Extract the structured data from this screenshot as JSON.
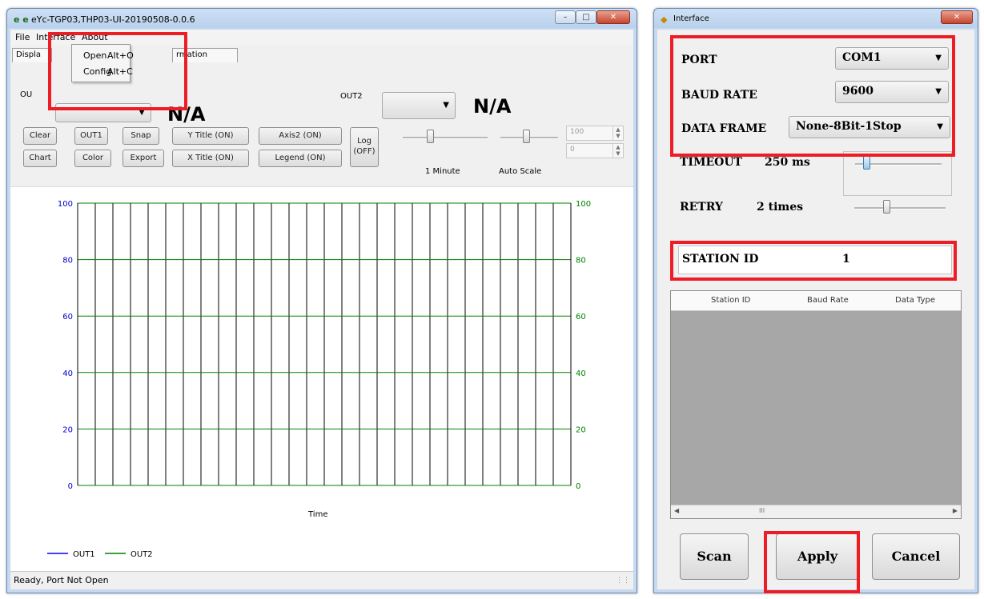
{
  "main_window": {
    "title": "eYc-TGP03,THP03-UI-20190508-0.0.6",
    "app_icon": "e e",
    "menu": {
      "file": "File",
      "interface": "Interface",
      "about": "About",
      "interface_items": [
        {
          "label": "Open",
          "accelerator": "Alt+O"
        },
        {
          "label": "Config",
          "accelerator": "Alt+C"
        }
      ]
    },
    "tabs": [
      {
        "label": "Displa"
      },
      {
        "label": "rmation"
      }
    ],
    "out1_label": "OU",
    "out1_value": "N/A",
    "out2_label": "OUT2",
    "out2_value": "N/A",
    "buttons_row1": [
      "Clear",
      "OUT1",
      "Snap",
      "Y Title (ON)",
      "Axis2 (ON)"
    ],
    "buttons_row2": [
      "Chart",
      "Color",
      "Export",
      "X Title (ON)",
      "Legend (ON)"
    ],
    "log_button": [
      "Log",
      "(OFF)"
    ],
    "time_slider_label": "1 Minute",
    "scale_slider_label": "Auto Scale",
    "spin_max": "100",
    "spin_min": "0",
    "status": "Ready,   Port Not Open"
  },
  "chart_data": {
    "type": "line",
    "xlabel": "Time",
    "ylim": [
      0,
      100
    ],
    "y2lim": [
      0,
      100
    ],
    "y_ticks": [
      0,
      20,
      40,
      60,
      80,
      100
    ],
    "y2_ticks": [
      0,
      20,
      40,
      60,
      80,
      100
    ],
    "vertical_gridlines": 28,
    "grid": true,
    "legend": "bottom-left",
    "series": [
      {
        "name": "OUT1",
        "color": "#0000ff",
        "values": []
      },
      {
        "name": "OUT2",
        "color": "#008000",
        "values": []
      }
    ],
    "colors": {
      "left_axis": "#0000cc",
      "right_axis": "#008000",
      "vgrid": "#000000",
      "hgrid": "#008000"
    }
  },
  "interface_dialog": {
    "title": "Interface",
    "port_label": "PORT",
    "port_value": "COM1",
    "baud_label": "BAUD RATE",
    "baud_value": "9600",
    "frame_label": "DATA FRAME",
    "frame_value": "None-8Bit-1Stop",
    "timeout_label": "TIMEOUT",
    "timeout_value": "250 ms",
    "retry_label": "RETRY",
    "retry_value": "2 times",
    "station_label": "STATION ID",
    "station_value": "1",
    "table_columns": [
      "Station ID",
      "Baud Rate",
      "Data Type"
    ],
    "scroll_thumb": "III",
    "buttons": {
      "scan": "Scan",
      "apply": "Apply",
      "cancel": "Cancel"
    }
  },
  "highlight_color": "#ee1c25"
}
